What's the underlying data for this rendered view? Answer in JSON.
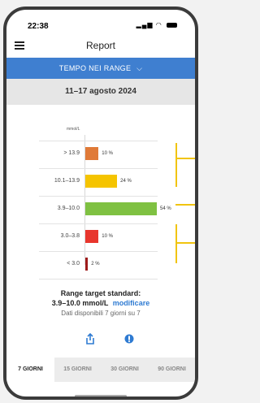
{
  "status_bar": {
    "time": "22:38"
  },
  "header": {
    "title": "Report"
  },
  "banner": {
    "label": "TEMPO NEI RANGE",
    "chevron": "⌵"
  },
  "date_range": "11–17 agosto 2024",
  "chart_data": {
    "type": "bar",
    "unit": "mmol/L",
    "categories": [
      "> 13.9",
      "10.1–13.9",
      "3.9–10.0",
      "3.0–3.8",
      "< 3.0"
    ],
    "values": [
      10,
      24,
      54,
      10,
      2
    ],
    "value_labels": [
      "10 %",
      "24 %",
      "54 %",
      "10 %",
      "2 %"
    ],
    "colors": [
      "#e07a38",
      "#f5c400",
      "#7fc142",
      "#e8362d",
      "#9e1b1b"
    ],
    "bracket_color": "#f1c40f"
  },
  "target": {
    "title": "Range target standard:",
    "range": "3.9–10.0 mmol/L",
    "edit_label": "modificare",
    "days": "Dati disponibili 7 giorni su 7"
  },
  "tabs": [
    "7 GIORNI",
    "15 GIORNI",
    "30 GIORNI",
    "90 GIORNI"
  ],
  "active_tab": 0,
  "icons": {
    "share": "share-icon",
    "info": "info-icon",
    "menu": "hamburger-menu-icon"
  }
}
